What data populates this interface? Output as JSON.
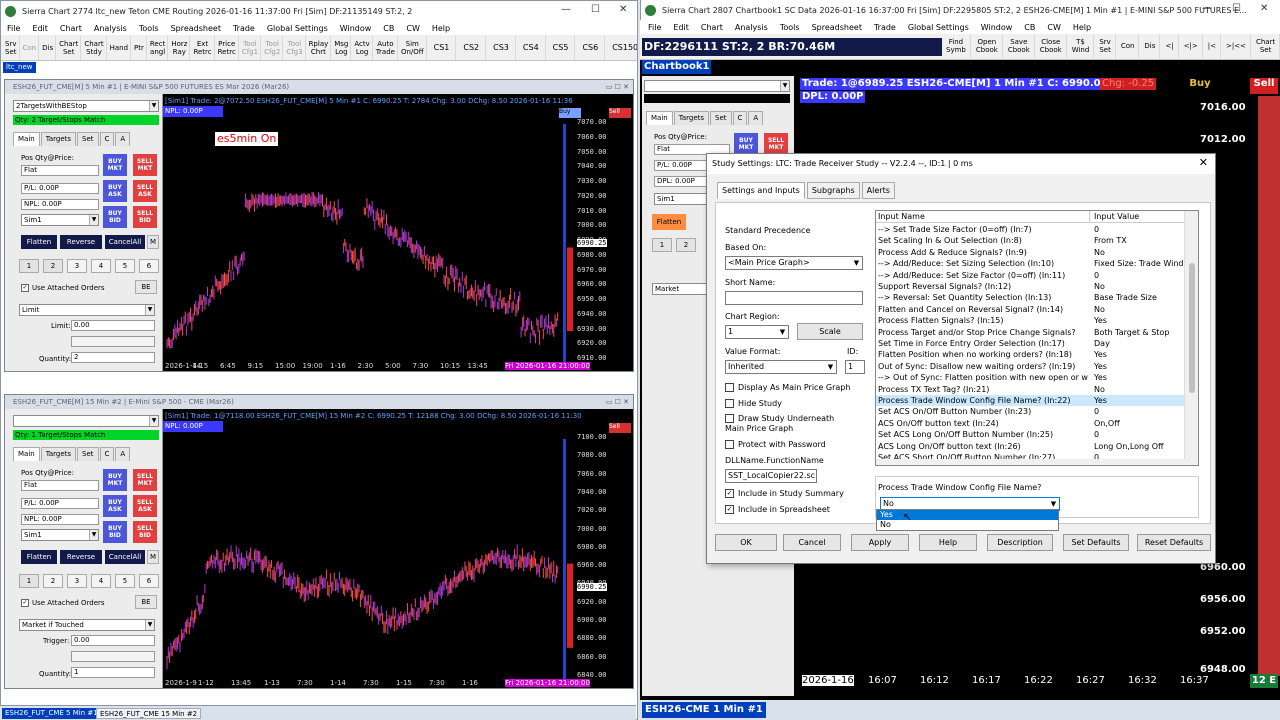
{
  "left_app": {
    "title": "Sierra Chart 2774 ltc_new Teton CME Routing 2026-01-16  11:37:00 Fri [Sim]  DF:21135149  ST:2, 2",
    "menu": [
      "File",
      "Edit",
      "Chart",
      "Analysis",
      "Tools",
      "Spreadsheet",
      "Trade",
      "Global Settings",
      "Window",
      "CB",
      "CW",
      "Help"
    ],
    "toolbar": [
      {
        "label": "Srv\nSet",
        "dim": false
      },
      {
        "label": "Con",
        "dim": true
      },
      {
        "label": "Dis",
        "dim": false
      },
      {
        "label": "Chart\nSet",
        "dim": false
      },
      {
        "label": "Chart\nStdy",
        "dim": false
      },
      {
        "label": "Hand",
        "dim": false
      },
      {
        "label": "Ptr",
        "dim": false
      },
      {
        "label": "Rect\nangl",
        "dim": false
      },
      {
        "label": "Horz\nRay",
        "dim": false
      },
      {
        "label": "Ext\nRetrc",
        "dim": false
      },
      {
        "label": "Price\nRetrc",
        "dim": false
      },
      {
        "label": "Tool\nCfg1",
        "dim": true
      },
      {
        "label": "Tool\nCfg2",
        "dim": true
      },
      {
        "label": "Tool\nCfg3",
        "dim": true
      },
      {
        "label": "Rplay\nChrt",
        "dim": false
      },
      {
        "label": "Msg\nLog",
        "dim": false
      },
      {
        "label": "Actv\nLog",
        "dim": false
      },
      {
        "label": "Auto\nTrade",
        "dim": false
      },
      {
        "label": "Sim\nOn/Off",
        "dim": false
      },
      {
        "label": "CS1",
        "dim": false
      },
      {
        "label": "CS2",
        "dim": false
      },
      {
        "label": "CS3",
        "dim": false
      },
      {
        "label": "CS4",
        "dim": false
      },
      {
        "label": "CS5",
        "dim": false
      },
      {
        "label": "CS6",
        "dim": false
      },
      {
        "label": "CS150",
        "dim": false
      }
    ],
    "tab_label": "ltc_new"
  },
  "chart1": {
    "header": "ESH26_FUT_CME[M]  5 Min  #1 | E-MINI S&P 500 FUTURES ES Mar 2026 (Mar26)",
    "study": "2TargetsWithBEStop",
    "qty_banner": "Qty: 2 Target/Stops Match",
    "info": "[Sim1]  Trade: 2@7072.50  ESH26_FUT_CME[M]  5 Min  #1  C: 6990.25  T: 2784  Chg: 3.00  DChg: 8.50  2026-01-16  11:36",
    "npl": "NPL: 0.00P",
    "overlay": "es5min On",
    "pos": "Flat",
    "pl": "P/L: 0.00P",
    "npl_field": "NPL: 0.00P",
    "account": "Sim1",
    "order_type": "Limit",
    "limit_label": "Limit:",
    "limit_value": "0.00",
    "qty_label": "Quantity:",
    "qty_value": "2",
    "y_labels": [
      "7070.00",
      "7060.00",
      "7050.00",
      "7040.00",
      "7030.00",
      "7020.00",
      "7010.00",
      "7000.00",
      "6990.00",
      "6980.00",
      "6970.00",
      "6960.00",
      "6950.00",
      "6940.00",
      "6930.00",
      "6920.00",
      "6910.00"
    ],
    "highlight_price": "6990.25",
    "x_labels": [
      "2026-1-14",
      "4:15",
      "6:45",
      "9:15",
      "15:00",
      "19:00",
      "1-16",
      "2:30",
      "5:00",
      "7:30",
      "10:15",
      "13:45"
    ],
    "x_last": "Fri 2026-01-16 21:00:00"
  },
  "chart2": {
    "header": "ESH26_FUT_CME[M]  15 Min  #2 | E-Mini S&P 500 - CME (Mar26)",
    "study": "",
    "qty_banner": "Qty: 1 Target/Stops Match",
    "info": "[Sim1]  Trade: 1@7118.00  ESH26_FUT_CME[M]  15 Min  #2  C: 6990.25  T: 12188  Chg: 3.00  DChg: 8.50  2026-01-16  11:30",
    "npl": "NPL: 0.00P",
    "pos": "Flat",
    "pl": "P/L: 0.00P",
    "npl_field": "NPL: 0.00P",
    "account": "Sim1",
    "order_type": "Market if Touched",
    "limit_label": "Trigger:",
    "limit_value": "0.00",
    "qty_label": "Quantity:",
    "qty_value": "1",
    "y_labels": [
      "7100.00",
      "7080.00",
      "7060.00",
      "7040.00",
      "7020.00",
      "7000.00",
      "6980.00",
      "6960.00",
      "6940.00",
      "6920.00",
      "6900.00",
      "6880.00",
      "6860.00",
      "6840.00"
    ],
    "highlight_price": "6990.25",
    "x_labels": [
      "2026-1-9",
      "1-12",
      "13:45",
      "1-13",
      "7:30",
      "1-14",
      "7:30",
      "1-15",
      "7:30",
      "1-16"
    ],
    "x_last": "Fri 2026-01-16 21:00:00"
  },
  "ttp_common": {
    "tabs": [
      "Main",
      "Targets",
      "Set",
      "C",
      "A"
    ],
    "pos_label": "Pos Qty@Price:",
    "buy_mkt": "BUY\nMKT",
    "sell_mkt": "SELL\nMKT",
    "buy_ask": "BUY\nASK",
    "sell_ask": "SELL\nASK",
    "buy_bid": "BUY\nBID",
    "sell_bid": "SELL\nBID",
    "flatten": "Flatten",
    "reverse": "Reverse",
    "cancel_all": "CancelAll",
    "m": "M",
    "nums": [
      "1",
      "2",
      "3",
      "4",
      "5",
      "6"
    ],
    "attached": "Use Attached Orders",
    "be": "BE"
  },
  "status_tabs": [
    "ESH26_FUT_CME  5 Min  #1",
    "ESH26_FUT_CME  15 Min  #2"
  ],
  "right_app": {
    "title": "Sierra Chart 2807 Chartbook1 SC Data 2026-01-16  16:37:00 Fri [Sim]  DF:2295805  ST:2, 2  ESH26-CME[M]  1 Min  #1 | E-MINI S&P 500 FUTURES E...",
    "menu": [
      "File",
      "Edit",
      "Chart",
      "Analysis",
      "Tools",
      "Spreadsheet",
      "Trade",
      "Global Settings",
      "Window",
      "CB",
      "CW",
      "Help"
    ],
    "df_bar": "DF:2296111  ST:2, 2  BR:70.46M",
    "toolbar": [
      "Find\nSymb",
      "Open\nCbook",
      "Save\nCbook",
      "Close\nCbook",
      "T$\nWind",
      "Srv\nSet",
      "Con",
      "Dis",
      "<|",
      "<|>",
      "|<",
      ">|<<",
      "Chart\nSet"
    ],
    "chartbook_tab": "Chartbook1",
    "trade_info": "Trade: 1@6989.25  ESH26-CME[M]  1 Min  #1  C: 6990.00  T: 3",
    "chg": "Chg: -0.25",
    "buy": "Buy",
    "sell": "Sell",
    "dpl": "DPL: 0.00P",
    "prices": [
      "7016.00",
      "7012.00",
      "6960.00",
      "6956.00",
      "6952.00",
      "6948.00"
    ],
    "time_labels": [
      "2026-1-16",
      "16:07",
      "16:12",
      "16:17",
      "16:22",
      "16:27",
      "16:32",
      "16:37"
    ],
    "bottom_tab": "ESH26-CME  1 Min  #1",
    "corner": "12 E"
  },
  "dialog": {
    "title": "Study Settings: LTC: Trade Receiver Study  -- V2.2.4 --, ID:1 | 0 ms",
    "tabs": [
      "Settings and Inputs",
      "Subgraphs",
      "Alerts"
    ],
    "standard_precedence": "Standard Precedence",
    "based_on_label": "Based On:",
    "based_on_value": "<Main Price Graph>",
    "short_name_label": "Short Name:",
    "short_name_value": "",
    "chart_region_label": "Chart Region:",
    "chart_region_value": "1",
    "scale_btn": "Scale",
    "value_format_label": "Value Format:",
    "value_format_value": "Inherited",
    "id_label": "ID:",
    "id_value": "1",
    "display_main": "Display As Main Price Graph",
    "hide_study": "Hide Study",
    "draw_under": "Draw Study Underneath\nMain Price Graph",
    "protect": "Protect with Password",
    "dll_label": "DLLName.FunctionName",
    "dll_value": "SST_LocalCopier22.sc",
    "incl_summary": "Include in Study Summary",
    "incl_spreadsheet": "Include in Spreadsheet",
    "grid_headers": [
      "Input Name",
      "Input Value"
    ],
    "inputs": [
      {
        "name": " --> Set Trade Size Factor (0=off)  (In:7)",
        "value": "0"
      },
      {
        "name": "Set Scaling In & Out Selection  (In:8)",
        "value": "From TX"
      },
      {
        "name": "Process Add & Reduce Signals?  (In:9)",
        "value": "No"
      },
      {
        "name": " --> Add/Reduce: Set Sizing Selection  (In:10)",
        "value": "Fixed Size: Trade Wind"
      },
      {
        "name": " --> Add/Reduce: Set Size Factor (0=off)  (In:11)",
        "value": "0"
      },
      {
        "name": "Support Reversal Signals?  (In:12)",
        "value": "No"
      },
      {
        "name": " --> Reversal: Set Quantity Selection  (In:13)",
        "value": "Base Trade Size"
      },
      {
        "name": "Flatten and Cancel on Reversal Signal?  (In:14)",
        "value": "No"
      },
      {
        "name": "Process Flatten Signals?  (In:15)",
        "value": "Yes"
      },
      {
        "name": "Process Target and/or Stop Price Change Signals?",
        "value": "Both Target & Stop"
      },
      {
        "name": "Set Time in Force Entry Order Selection  (In:17)",
        "value": "Day"
      },
      {
        "name": "Flatten Position when no working orders?  (In:18)",
        "value": "Yes"
      },
      {
        "name": "Out of Sync: Disallow new waiting orders?  (In:19)",
        "value": "Yes"
      },
      {
        "name": " --> Out of Sync: Flatten position with new open or wa...",
        "value": "Yes"
      },
      {
        "name": "Process TX Text Tag?  (In:21)",
        "value": "No"
      },
      {
        "name": "Process Trade Window Config File Name?  (In:22)",
        "value": "Yes"
      },
      {
        "name": "Set ACS On/Off Button Number  (In:23)",
        "value": "0"
      },
      {
        "name": "ACS On/Off button text  (In:24)",
        "value": "On,Off"
      },
      {
        "name": "Set ACS Long On/Off Button Number  (In:25)",
        "value": "0"
      },
      {
        "name": "ACS Long On/Off button text  (In:26)",
        "value": "Long On,Long Off"
      },
      {
        "name": "Set ACS Short On/Off Button Number  (In:27)",
        "value": "0"
      }
    ],
    "selected_row": 15,
    "editor_label": "Process Trade Window Config File Name?",
    "editor_value": "No",
    "dropdown_options": [
      "Yes",
      "No"
    ],
    "dropdown_highlight": "Yes",
    "buttons": [
      "OK",
      "Cancel",
      "Apply",
      "Help",
      "Description",
      "Set Defaults",
      "Reset Defaults"
    ]
  },
  "colors": {
    "buy": "#4b56d8",
    "sell": "#e04040",
    "bars": "#b33ad6",
    "green": "#00d428",
    "navy": "#121a4a",
    "highlight": "#0078d7"
  }
}
